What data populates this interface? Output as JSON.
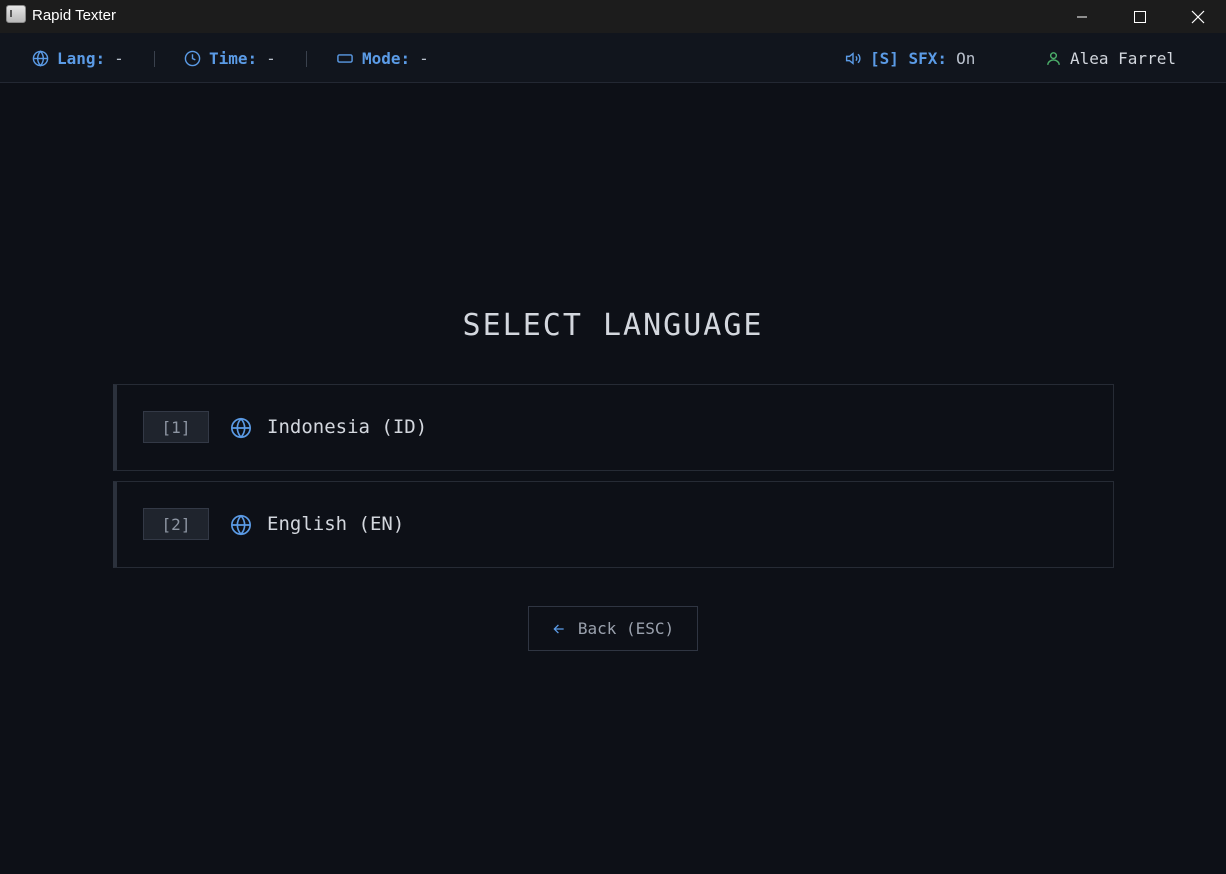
{
  "window": {
    "title": "Rapid Texter"
  },
  "statusbar": {
    "lang_label": "Lang:",
    "lang_value": "-",
    "time_label": "Time:",
    "time_value": "-",
    "mode_label": "Mode:",
    "mode_value": "-",
    "sfx_label": "[S] SFX:",
    "sfx_value": "On",
    "user_name": "Alea Farrel"
  },
  "main": {
    "heading": "SELECT LANGUAGE",
    "options": [
      {
        "key": "[1]",
        "label": "Indonesia (ID)",
        "icon": "globe-icon"
      },
      {
        "key": "[2]",
        "label": "English (EN)",
        "icon": "globe-icon"
      }
    ],
    "back_label": "Back (ESC)"
  },
  "colors": {
    "background": "#0d1017",
    "statusbar": "#11151d",
    "accent": "#5b9be6",
    "user_icon": "#4caf6a",
    "text": "#d3d7de"
  }
}
